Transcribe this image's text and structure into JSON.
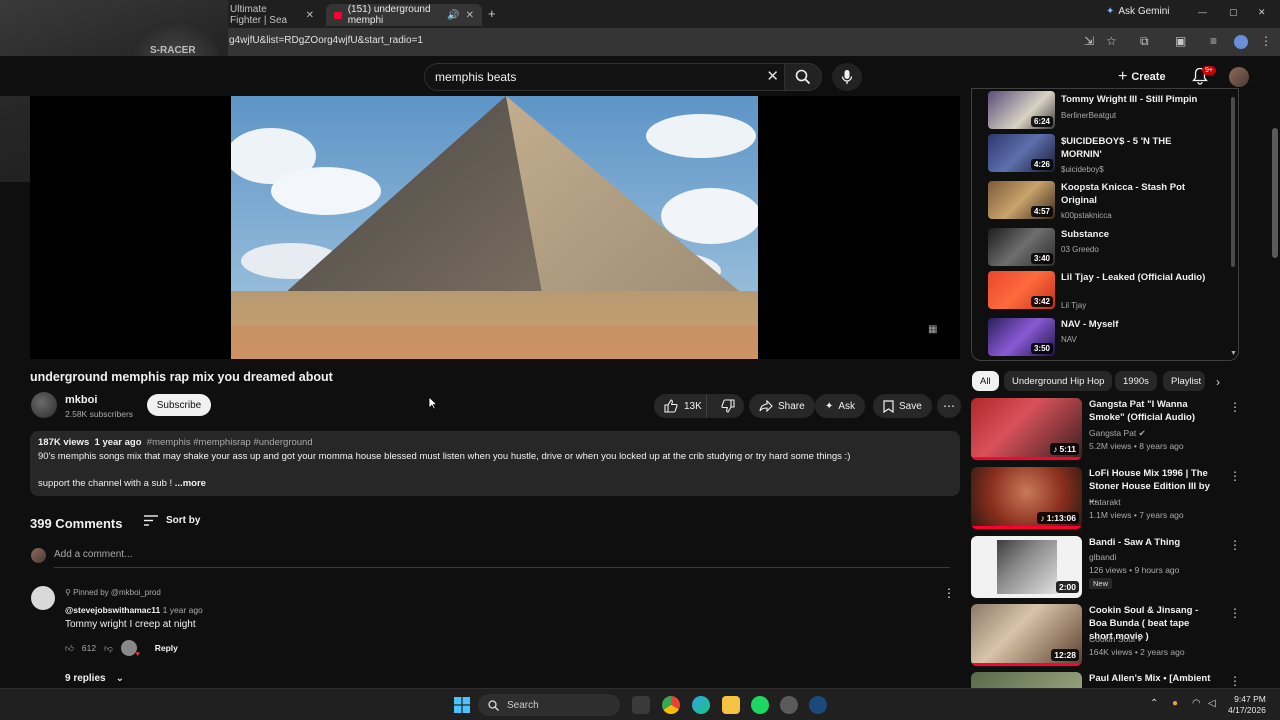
{
  "browser": {
    "tabs": [
      {
        "label": "Ultimate Fighter | Sea",
        "close": "✕"
      },
      {
        "label": "(151) underground memphi",
        "close": "✕",
        "audio": "🔊"
      }
    ],
    "new_tab": "+",
    "ask_gemini": "Ask Gemini",
    "url": "g4wjfU&list=RDgZOorg4wjfU&start_radio=1",
    "window_controls": [
      "—",
      "▢",
      "✕"
    ]
  },
  "webcam": {
    "cap_text": "S-RACER"
  },
  "header": {
    "search_value": "memphis beats",
    "create_label": "Create",
    "notifications_badge": "9+"
  },
  "video": {
    "title": "underground memphis rap mix you dreamed about",
    "channel": "mkboi",
    "subscribers": "2.58K subscribers",
    "subscribe_label": "Subscribe",
    "likes": "13K",
    "share_label": "Share",
    "ask_label": "Ask",
    "save_label": "Save"
  },
  "description": {
    "views": "187K views",
    "age": "1 year ago",
    "tags": "#memphis #memphisrap #underground",
    "line1": "90's memphis songs mix that may shake your ass up and got your momma house blessed  must listen when you hustle, drive or when you locked up at the crib studying or try hard some things :)",
    "line2": "support the channel with a sub ! ",
    "more": "...more"
  },
  "comments": {
    "count": "399 Comments",
    "sort_label": "Sort by",
    "add_placeholder": "Add a comment...",
    "pinned_by": "Pinned by @mkboi_prod",
    "author": "@stevejobswithamac11",
    "time": "1 year ago",
    "text": "Tommy wright I creep at night",
    "likes": "612",
    "reply_label": "Reply",
    "replies_label": "9 replies"
  },
  "playlist": [
    {
      "title": "Tommy Wright III - Still Pimpin",
      "channel": "BerlinerBeatgut",
      "duration": "6:24"
    },
    {
      "title": "$UICIDEBOY$ - 5 'N THE MORNIN'",
      "channel": "$uicideboy$",
      "duration": "4:26"
    },
    {
      "title": "Koopsta Knicca - Stash Pot Original",
      "channel": "k00pstaknicca",
      "duration": "4:57"
    },
    {
      "title": "Substance",
      "channel": "03 Greedo",
      "duration": "3:40"
    },
    {
      "title": "Lil Tjay - Leaked (Official Audio)",
      "channel": "Lil Tjay",
      "duration": "3:42"
    },
    {
      "title": "NAV - Myself",
      "channel": "NAV",
      "duration": "3:50"
    }
  ],
  "chips": [
    "All",
    "Underground Hip Hop",
    "1990s",
    "Playlist"
  ],
  "recommendations": [
    {
      "title": "Gangsta Pat \"I Wanna Smoke\" (Official Audio)",
      "channel": "Gangsta Pat",
      "meta": "5.2M views • 8 years ago",
      "duration": "5:11"
    },
    {
      "title": "LoFi House Mix 1996 | The Stoner House Edition III by ...",
      "channel": "Katarakt",
      "meta": "1.1M views • 7 years ago",
      "duration": "1:13:06"
    },
    {
      "title": "Bandi - Saw A Thing",
      "channel": "glbandi",
      "meta": "126 views • 9 hours ago",
      "badge": "New",
      "duration": "2:00"
    },
    {
      "title": "Cookin Soul & Jinsang - Boa Bunda ( beat tape short movie )",
      "channel": "Cookin Soul",
      "meta": "164K views • 2 years ago",
      "duration": "12:28"
    },
    {
      "title": "Paul Allen's Mix • [Ambient",
      "channel": "",
      "meta": "",
      "duration": ""
    }
  ],
  "taskbar": {
    "search_label": "Search",
    "time": "9:47 PM",
    "date": "4/17/2026"
  },
  "colors": {
    "accent_red": "#ff0033",
    "bg": "#0f0f0f",
    "surface": "#272727"
  }
}
